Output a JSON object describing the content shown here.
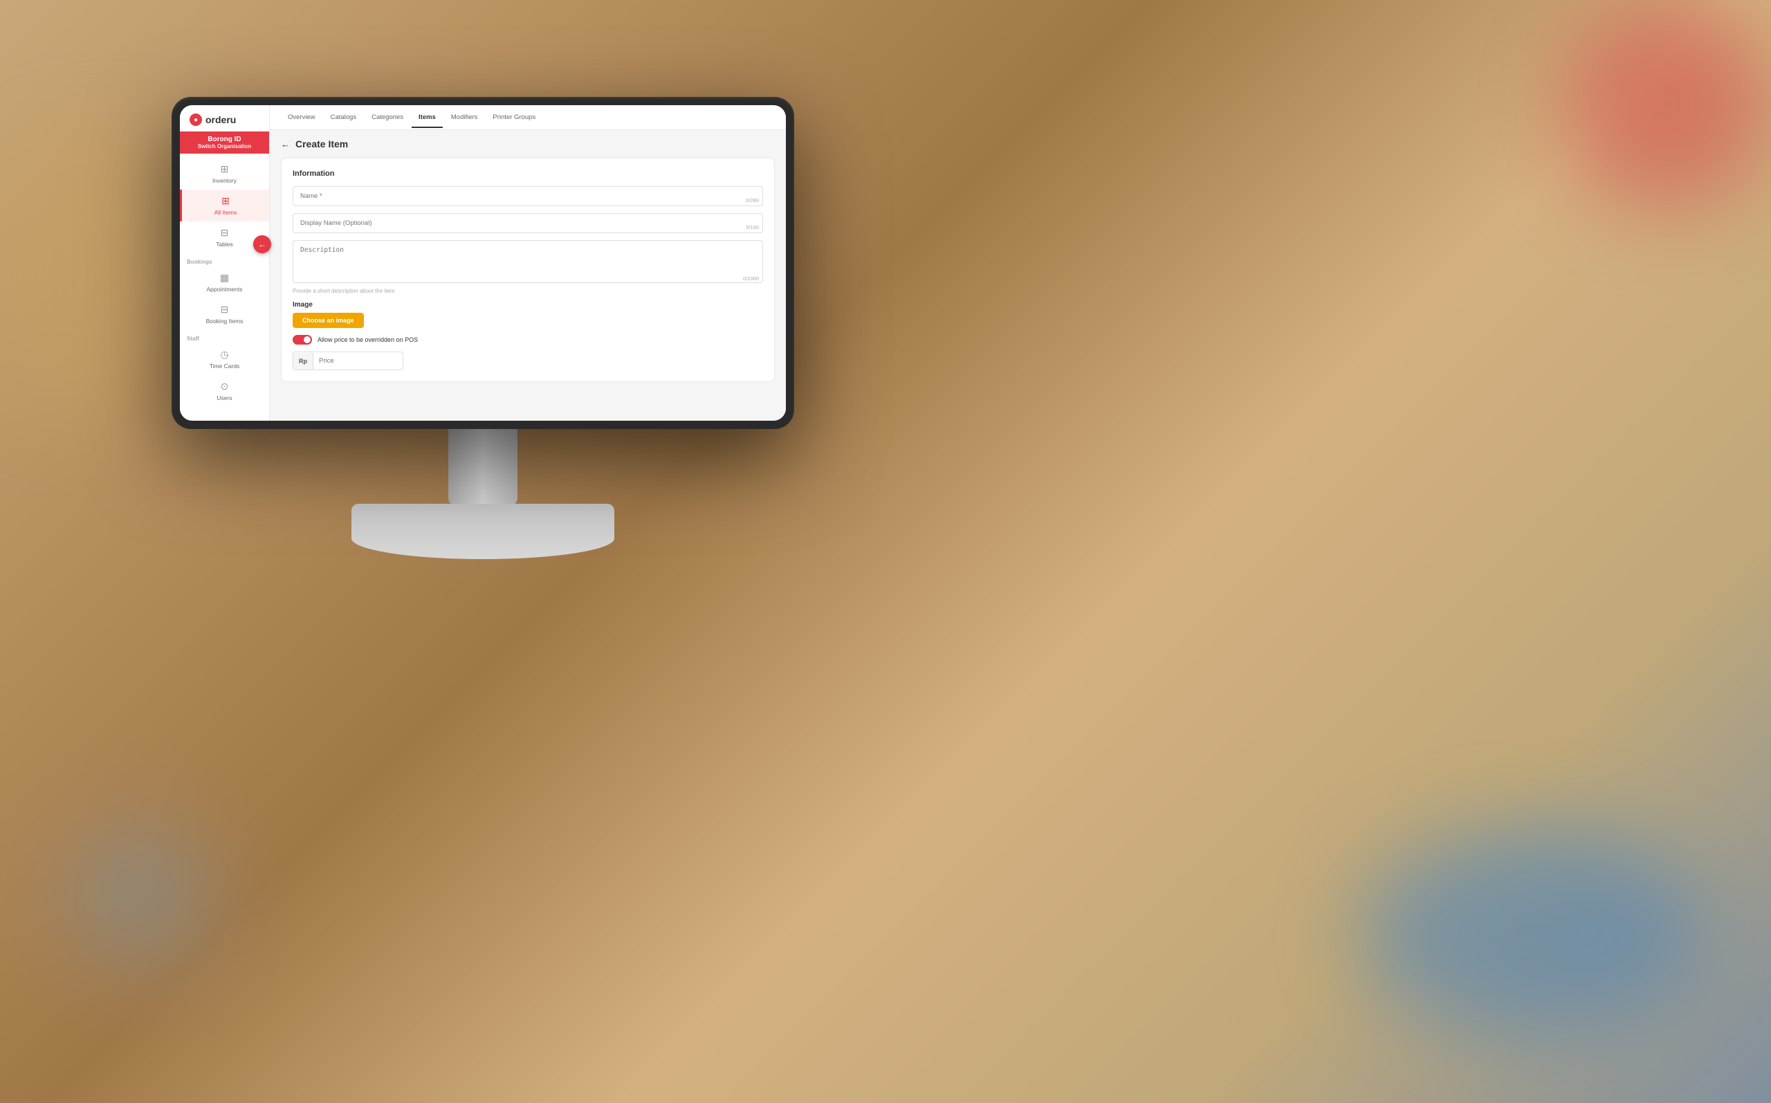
{
  "brand": {
    "logo_text": "orderu",
    "logo_icon": "●"
  },
  "org": {
    "name": "Borong ID",
    "sub_label": "Switch Organisation"
  },
  "sidebar": {
    "nav_items": [
      {
        "id": "inventory",
        "label": "Inventory",
        "icon": "▦",
        "active": false
      },
      {
        "id": "all-items",
        "label": "All Items",
        "icon": "⊞",
        "active": true
      },
      {
        "id": "tables",
        "label": "Tables",
        "icon": "⊟",
        "active": false
      }
    ],
    "bookings_label": "Bookings",
    "bookings_items": [
      {
        "id": "appointments",
        "label": "Appointments",
        "icon": "▦"
      },
      {
        "id": "booking-items",
        "label": "Booking Items",
        "icon": "⊟"
      }
    ],
    "staff_label": "Staff",
    "staff_items": [
      {
        "id": "time-cards",
        "label": "Time Cards",
        "icon": "◷"
      },
      {
        "id": "users",
        "label": "Users",
        "icon": "⊙"
      }
    ]
  },
  "tabs": [
    {
      "id": "overview",
      "label": "Overview",
      "active": false
    },
    {
      "id": "catalogs",
      "label": "Catalogs",
      "active": false
    },
    {
      "id": "categories",
      "label": "Categories",
      "active": false
    },
    {
      "id": "items",
      "label": "Items",
      "active": true
    },
    {
      "id": "modifiers",
      "label": "Modifiers",
      "active": false
    },
    {
      "id": "printer-groups",
      "label": "Printer Groups",
      "active": false
    }
  ],
  "page": {
    "back_arrow": "←",
    "title": "Create Item"
  },
  "form": {
    "section_title": "Information",
    "name_placeholder": "Name *",
    "name_char_count": "0/280",
    "display_name_placeholder": "Display Name (Optional)",
    "display_name_char_count": "0/100",
    "description_placeholder": "Description",
    "description_hint": "Provide a short description about the item",
    "description_char_count": "0/1000",
    "image_label": "Image",
    "choose_image_btn": "Choose an image",
    "toggle_label": "Allow price to be overridden on POS",
    "price_prefix": "Rp",
    "price_placeholder": "Price"
  },
  "back_button_icon": "←"
}
